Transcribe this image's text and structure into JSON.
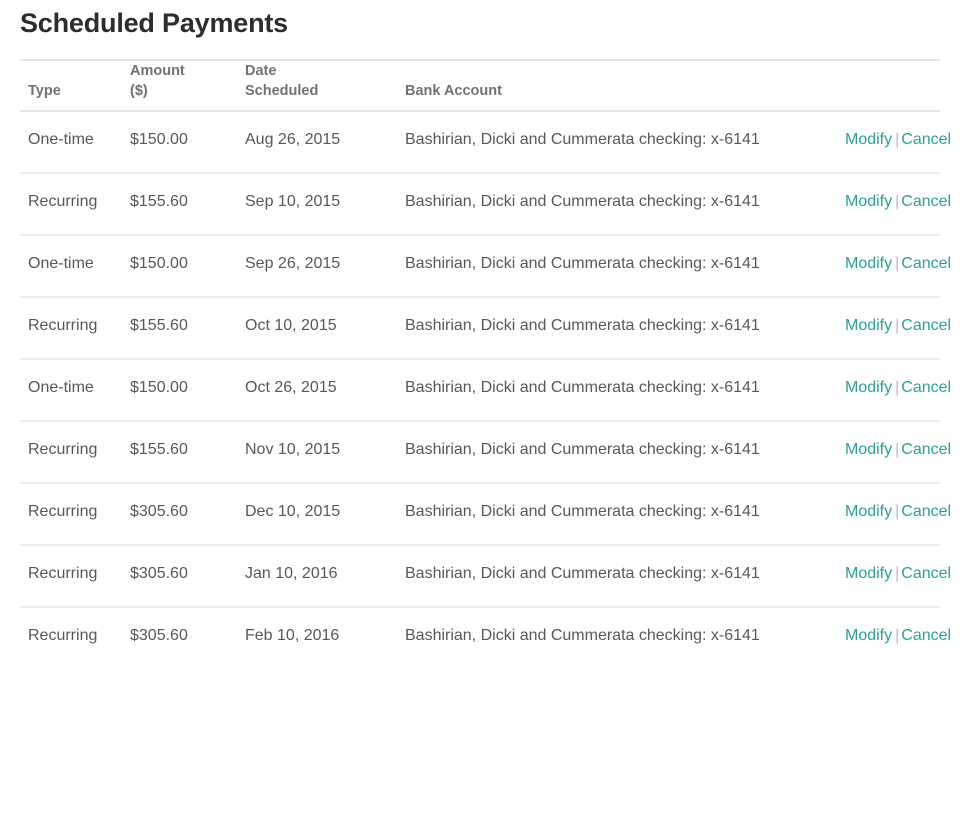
{
  "header": {
    "title": "Scheduled Payments"
  },
  "colors": {
    "link": "#2aa198",
    "title_text": "#2d2d2d",
    "body_text": "#58585a",
    "header_text": "#6f7276",
    "rule": "#e6e6e7",
    "row_border": "#ececed",
    "separator": "#b9bbbd"
  },
  "table": {
    "columns": [
      {
        "key": "type",
        "label": "Type"
      },
      {
        "key": "amount",
        "label_line1": "Amount",
        "label_line2": "($)"
      },
      {
        "key": "date",
        "label_line1": "Date",
        "label_line2": "Scheduled"
      },
      {
        "key": "bank",
        "label": "Bank Account"
      },
      {
        "key": "actions",
        "label": ""
      }
    ],
    "actions": {
      "modify_label": "Modify",
      "cancel_label": "Cancel",
      "separator": "|"
    },
    "rows": [
      {
        "type": "One-time",
        "amount": "$150.00",
        "date": "Aug 26, 2015",
        "bank": "Bashirian, Dicki and Cummerata checking: x-6141"
      },
      {
        "type": "Recurring",
        "amount": "$155.60",
        "date": "Sep 10, 2015",
        "bank": "Bashirian, Dicki and Cummerata checking: x-6141"
      },
      {
        "type": "One-time",
        "amount": "$150.00",
        "date": "Sep 26, 2015",
        "bank": "Bashirian, Dicki and Cummerata checking: x-6141"
      },
      {
        "type": "Recurring",
        "amount": "$155.60",
        "date": "Oct 10, 2015",
        "bank": "Bashirian, Dicki and Cummerata checking: x-6141"
      },
      {
        "type": "One-time",
        "amount": "$150.00",
        "date": "Oct 26, 2015",
        "bank": "Bashirian, Dicki and Cummerata checking: x-6141"
      },
      {
        "type": "Recurring",
        "amount": "$155.60",
        "date": "Nov 10, 2015",
        "bank": "Bashirian, Dicki and Cummerata checking: x-6141"
      },
      {
        "type": "Recurring",
        "amount": "$305.60",
        "date": "Dec 10, 2015",
        "bank": "Bashirian, Dicki and Cummerata checking: x-6141"
      },
      {
        "type": "Recurring",
        "amount": "$305.60",
        "date": "Jan 10, 2016",
        "bank": "Bashirian, Dicki and Cummerata checking: x-6141"
      },
      {
        "type": "Recurring",
        "amount": "$305.60",
        "date": "Feb 10, 2016",
        "bank": "Bashirian, Dicki and Cummerata checking: x-6141"
      }
    ]
  }
}
